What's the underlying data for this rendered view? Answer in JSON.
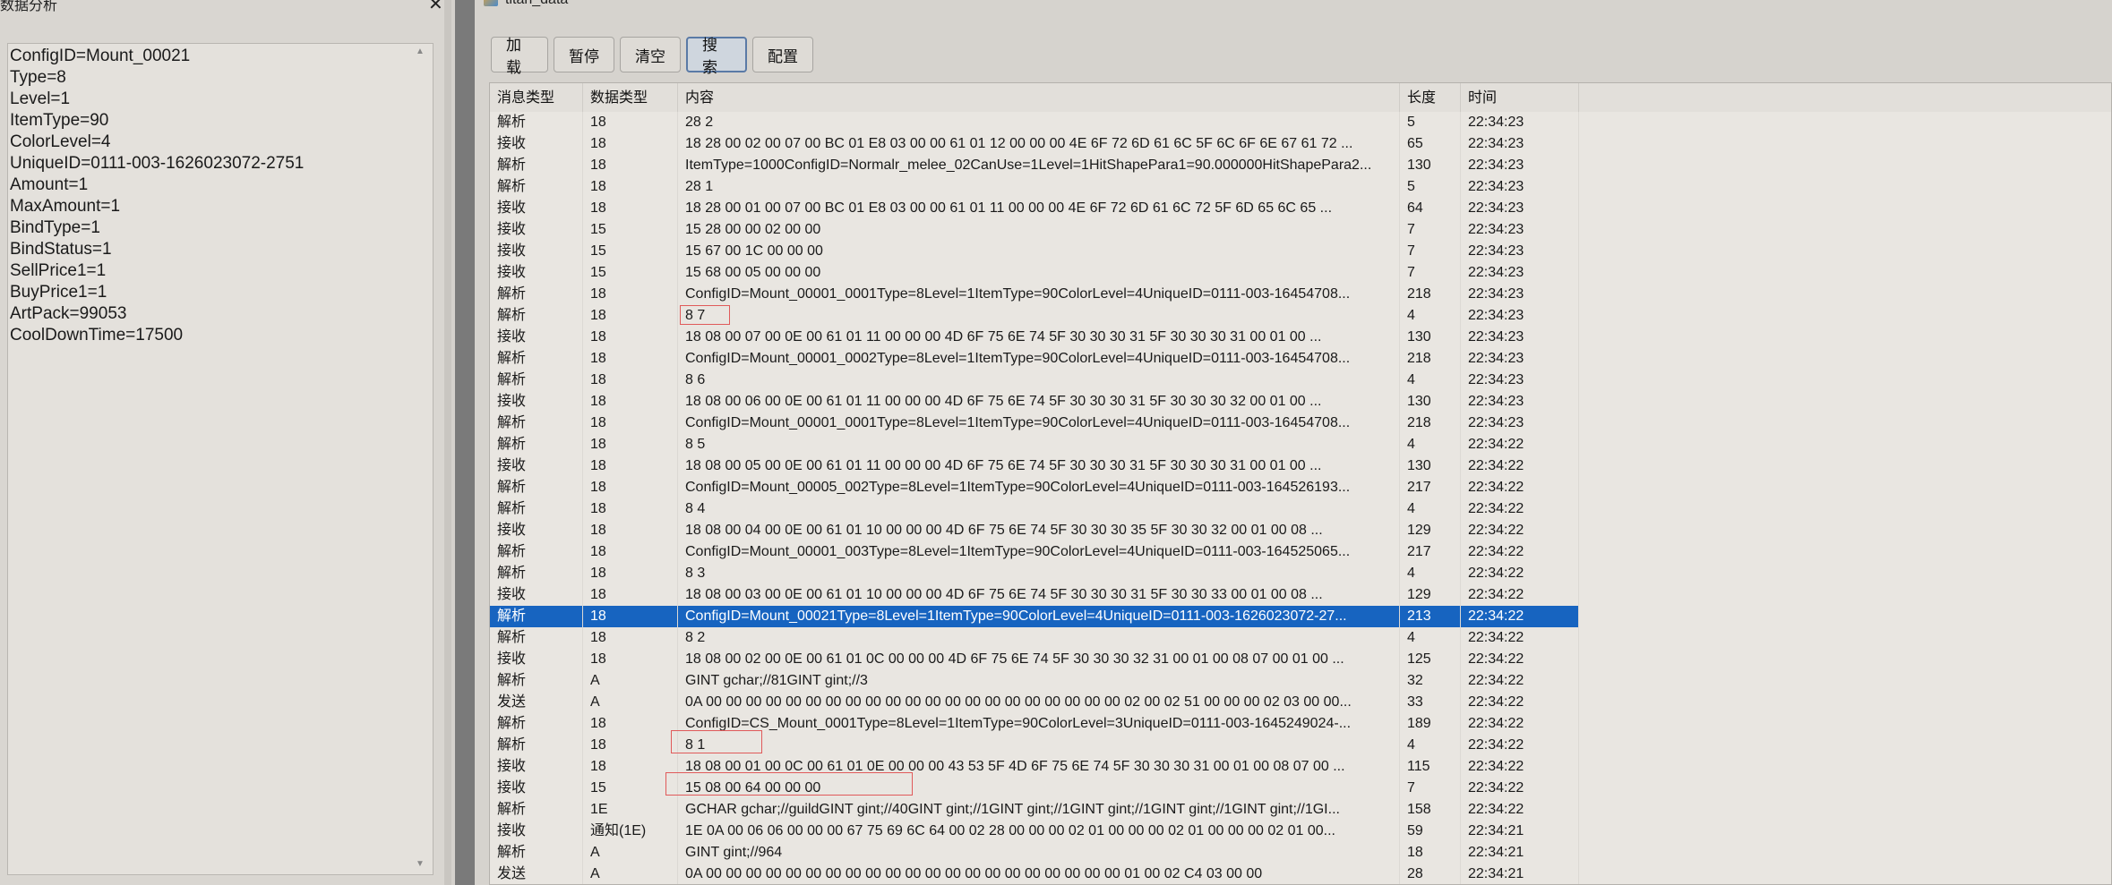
{
  "left_panel": {
    "title": "数据分析",
    "close_symbol": "✕",
    "lines": [
      "ConfigID=Mount_00021",
      "Type=8",
      "Level=1",
      "ItemType=90",
      "ColorLevel=4",
      "UniqueID=0111-003-1626023072-2751",
      "Amount=1",
      "MaxAmount=1",
      "BindType=1",
      "BindStatus=1",
      "SellPrice1=1",
      "BuyPrice1=1",
      "ArtPack=99053",
      "CoolDownTime=17500"
    ]
  },
  "window": {
    "title": "titan_data",
    "icon": "app-icon"
  },
  "toolbar": [
    "加载",
    "暂停",
    "清空",
    "搜索",
    "配置"
  ],
  "table": {
    "headers": [
      "消息类型",
      "数据类型",
      "内容",
      "长度",
      "时间"
    ],
    "selected_index": 23,
    "rows": [
      [
        "解析",
        "18",
        "28 2",
        "5",
        "22:34:23"
      ],
      [
        "接收",
        "18",
        "18 28 00 02 00 07 00 BC 01 E8 03 00 00 61 01 12 00 00 00 4E 6F 72 6D 61 6C 5F 6C 6F 6E 67 61 72 ...",
        "65",
        "22:34:23"
      ],
      [
        "解析",
        "18",
        "ItemType=1000ConfigID=Normalr_melee_02CanUse=1Level=1HitShapePara1=90.000000HitShapePara2...",
        "130",
        "22:34:23"
      ],
      [
        "解析",
        "18",
        "28 1",
        "5",
        "22:34:23"
      ],
      [
        "接收",
        "18",
        "18 28 00 01 00 07 00 BC 01 E8 03 00 00 61 01 11 00 00 00 4E 6F 72 6D 61 6C 72 5F 6D 65 6C 65 ...",
        "64",
        "22:34:23"
      ],
      [
        "接收",
        "15",
        "15 28 00 00 02 00 00",
        "7",
        "22:34:23"
      ],
      [
        "接收",
        "15",
        "15 67 00 1C 00 00 00",
        "7",
        "22:34:23"
      ],
      [
        "接收",
        "15",
        "15 68 00 05 00 00 00",
        "7",
        "22:34:23"
      ],
      [
        "解析",
        "18",
        "ConfigID=Mount_00001_0001Type=8Level=1ItemType=90ColorLevel=4UniqueID=0111-003-16454708...",
        "218",
        "22:34:23"
      ],
      [
        "解析",
        "18",
        "8 7",
        "4",
        "22:34:23"
      ],
      [
        "接收",
        "18",
        "18 08 00 07 00 0E 00 61 01 11 00 00 00 4D 6F 75 6E 74 5F 30 30 30 31 5F 30 30 30 31 00 01 00 ...",
        "130",
        "22:34:23"
      ],
      [
        "解析",
        "18",
        "ConfigID=Mount_00001_0002Type=8Level=1ItemType=90ColorLevel=4UniqueID=0111-003-16454708...",
        "218",
        "22:34:23"
      ],
      [
        "解析",
        "18",
        "8 6",
        "4",
        "22:34:23"
      ],
      [
        "接收",
        "18",
        "18 08 00 06 00 0E 00 61 01 11 00 00 00 4D 6F 75 6E 74 5F 30 30 30 31 5F 30 30 30 32 00 01 00 ...",
        "130",
        "22:34:23"
      ],
      [
        "解析",
        "18",
        "ConfigID=Mount_00001_0001Type=8Level=1ItemType=90ColorLevel=4UniqueID=0111-003-16454708...",
        "218",
        "22:34:23"
      ],
      [
        "解析",
        "18",
        "8 5",
        "4",
        "22:34:22"
      ],
      [
        "接收",
        "18",
        "18 08 00 05 00 0E 00 61 01 11 00 00 00 4D 6F 75 6E 74 5F 30 30 30 31 5F 30 30 30 31 00 01 00 ...",
        "130",
        "22:34:22"
      ],
      [
        "解析",
        "18",
        "ConfigID=Mount_00005_002Type=8Level=1ItemType=90ColorLevel=4UniqueID=0111-003-164526193...",
        "217",
        "22:34:22"
      ],
      [
        "解析",
        "18",
        "8 4",
        "4",
        "22:34:22"
      ],
      [
        "接收",
        "18",
        "18 08 00 04 00 0E 00 61 01 10 00 00 00 4D 6F 75 6E 74 5F 30 30 30 35 5F 30 30 32 00 01 00 08 ...",
        "129",
        "22:34:22"
      ],
      [
        "解析",
        "18",
        "ConfigID=Mount_00001_003Type=8Level=1ItemType=90ColorLevel=4UniqueID=0111-003-164525065...",
        "217",
        "22:34:22"
      ],
      [
        "解析",
        "18",
        "8 3",
        "4",
        "22:34:22"
      ],
      [
        "接收",
        "18",
        "18 08 00 03 00 0E 00 61 01 10 00 00 00 4D 6F 75 6E 74 5F 30 30 30 31 5F 30 30 33 00 01 00 08 ...",
        "129",
        "22:34:22"
      ],
      [
        "解析",
        "18",
        "ConfigID=Mount_00021Type=8Level=1ItemType=90ColorLevel=4UniqueID=0111-003-1626023072-27...",
        "213",
        "22:34:22"
      ],
      [
        "解析",
        "18",
        "8 2",
        "4",
        "22:34:22"
      ],
      [
        "接收",
        "18",
        "18 08 00 02 00 0E 00 61 01 0C 00 00 00 4D 6F 75 6E 74 5F 30 30 30 32 31 00 01 00 08 07 00 01 00 ...",
        "125",
        "22:34:22"
      ],
      [
        "解析",
        "A",
        "GINT gchar;//81GINT gint;//3",
        "32",
        "22:34:22"
      ],
      [
        "发送",
        "A",
        "0A 00 00 00 00 00 00 00 00 00 00 00 00 00 00 00 00 00 00 00 00 00 02 00 02 51 00 00 00 02 03 00 00...",
        "33",
        "22:34:22"
      ],
      [
        "解析",
        "18",
        "ConfigID=CS_Mount_0001Type=8Level=1ItemType=90ColorLevel=3UniqueID=0111-003-1645249024-...",
        "189",
        "22:34:22"
      ],
      [
        "解析",
        "18",
        "8 1",
        "4",
        "22:34:22"
      ],
      [
        "接收",
        "18",
        "18 08 00 01 00 0C 00 61 01 0E 00 00 00 43 53 5F 4D 6F 75 6E 74 5F 30 30 30 31 00 01 00 08 07 00 ...",
        "115",
        "22:34:22"
      ],
      [
        "接收",
        "15",
        "15 08 00 64 00 00 00",
        "7",
        "22:34:22"
      ],
      [
        "解析",
        "1E",
        "GCHAR gchar;//guildGINT gint;//40GINT gint;//1GINT gint;//1GINT gint;//1GINT gint;//1GINT gint;//1GI...",
        "158",
        "22:34:22"
      ],
      [
        "接收",
        "通知(1E)",
        "1E 0A 00 06 06 00 00 00 67 75 69 6C 64 00 02 28 00 00 00 02 01 00 00 00 02 01 00 00 00 02 01 00...",
        "59",
        "22:34:21"
      ],
      [
        "解析",
        "A",
        "GINT gint;//964",
        "18",
        "22:34:21"
      ],
      [
        "发送",
        "A",
        "0A 00 00 00 00 00 00 00 00 00 00 00 00 00 00 00 00 00 00 00 00 00 01 00 02 C4 03 00 00",
        "28",
        "22:34:21"
      ]
    ]
  }
}
